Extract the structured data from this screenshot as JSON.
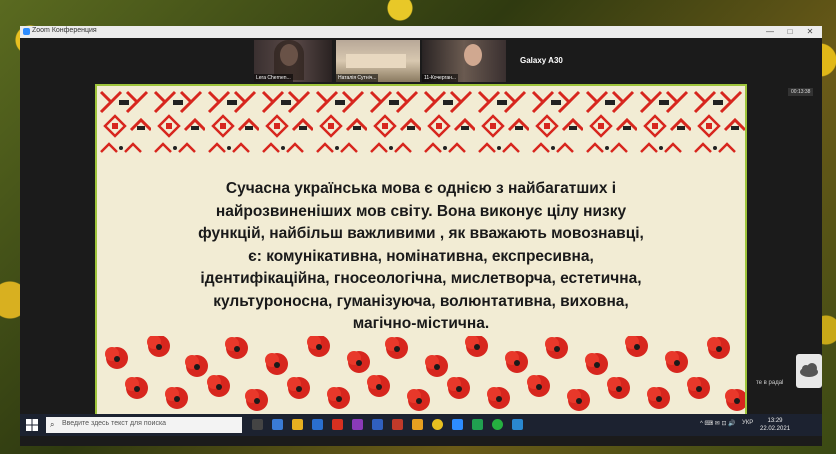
{
  "window": {
    "title": "Zoom Конференция",
    "minimize": "—",
    "maximize": "□",
    "close": "✕"
  },
  "participants": [
    {
      "name": "Lera Chernen..."
    },
    {
      "name": "Наталія Сутніч..."
    },
    {
      "name": "11-Кочерган..."
    }
  ],
  "galaxy_label": "Galaxy A30",
  "timer": "00:13:38",
  "slide": {
    "lines": [
      "Сучасна українська мова є однією з найбагатших і",
      "найрозвиненіших мов світу. Вона виконує цілу низку",
      "функцій, найбільш важливими , як вважають мовознавці,",
      "є: комунікативна, номінативна, експресивна,",
      "ідентифікаційна, гносеологічна, мислетворча, естетична,",
      "культуроносна, гуманізуюча, волюнтативна, виховна,",
      "магічно-містична."
    ]
  },
  "taskbar": {
    "search_placeholder": "Введите здесь текст для поиска",
    "lang": "УКР",
    "time": "13:29",
    "date": "22.02.2021",
    "tray": "^ ⌨ ✉ ⊡ 🔊"
  },
  "notification": {
    "text": "те в радаl"
  },
  "colors": {
    "red": "#d7261e",
    "border": "#9ec43a",
    "bg": "#f2ecd4"
  }
}
